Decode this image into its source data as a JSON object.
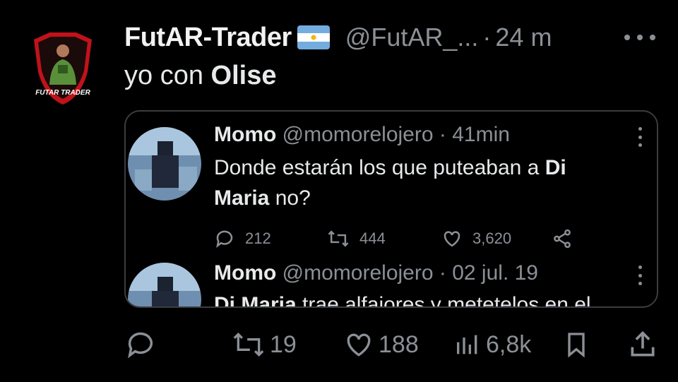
{
  "post": {
    "display_name": "FutAR-Trader",
    "handle": "@FutAR_...",
    "separator": "·",
    "time": "24 m",
    "text_plain": "yo con ",
    "text_bold": "Olise",
    "avatar_caption": "FUTAR TRADER"
  },
  "quote": {
    "tweet1": {
      "name": "Momo",
      "handle": "@momorelojero",
      "separator": "·",
      "time": "41min",
      "text_a": "Donde estarán los que puteaban a ",
      "text_bold": "Di",
      "text_b_bold": "Maria",
      "text_c": " no?",
      "replies": "212",
      "retweets": "444",
      "likes": "3,620"
    },
    "tweet2": {
      "name": "Momo",
      "handle": "@momorelojero",
      "separator": "·",
      "time": "02 jul. 19",
      "text_bold": "Di Maria",
      "text_rest": " trae alfajores y metetelos en el"
    }
  },
  "actions": {
    "replies": "",
    "retweets": "19",
    "likes": "188",
    "views": "6,8k"
  },
  "icons": {
    "more": "more-horizontal-icon",
    "reply": "reply-icon",
    "retweet": "retweet-icon",
    "like": "heart-icon",
    "views": "views-icon",
    "bookmark": "bookmark-icon",
    "share": "share-icon"
  },
  "colors": {
    "background": "#000000",
    "text": "#e7e9ea",
    "muted": "#8b9096",
    "avatar_red": "#c0121a"
  }
}
